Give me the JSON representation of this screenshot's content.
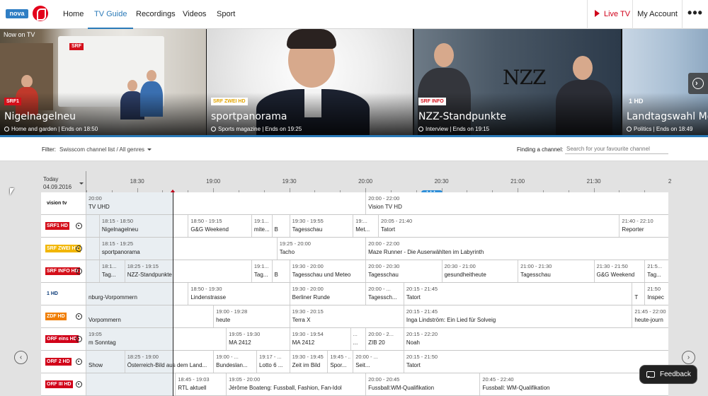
{
  "nav": {
    "logo_text": "nova",
    "items": [
      "Home",
      "TV Guide",
      "Recordings",
      "Videos",
      "Sport"
    ],
    "active_item": "TV Guide",
    "live_label": "Live TV",
    "account_label": "My Account",
    "more_label": "•••"
  },
  "hero": {
    "section_label": "Now on TV",
    "tiles": [
      {
        "title": "Nigelnagelneu",
        "meta": "Home and garden | Ends on 18:50",
        "channel": "SRF1"
      },
      {
        "title": "sportpanorama",
        "meta": "Sports magazine | Ends on 19:25",
        "channel": "SRF ZWEI HD"
      },
      {
        "title": "NZZ-Standpunkte",
        "meta": "Interview | Ends on 19:15",
        "channel": "SRF INFO"
      },
      {
        "title": "Landtagswahl Me",
        "meta": "Politics | Ends on 18:49",
        "channel": "1 HD"
      }
    ],
    "tile_texts": {
      "tile1_sign": "SRF",
      "tile3_logo": "NZZ"
    }
  },
  "filter": {
    "label": "Filter:",
    "value": "Swisscom channel list / All genres",
    "finding_label": "Finding a channel:",
    "search_placeholder": "Search for your favourite channel"
  },
  "guide": {
    "day": "Today",
    "date": "04.09.2016",
    "times": [
      "18:30",
      "19:00",
      "19:30",
      "20:00",
      "20:30",
      "21:00",
      "21:30",
      "2"
    ],
    "start_time": "18:10",
    "now_time": "18:44",
    "channels": [
      {
        "logo": "vision tv",
        "recordable": false,
        "programs": [
          {
            "start": "",
            "end": "20:00",
            "time": "20:00",
            "name": "TV UHD"
          },
          {
            "start": "20:00",
            "end": "22:00",
            "time": "20:00 - 22:00",
            "name": "Vision TV HD"
          }
        ]
      },
      {
        "logo": "SRF1 HD",
        "recordable": true,
        "programs": [
          {
            "start": "18:15",
            "end": "18:50",
            "time": "18:15 - 18:50",
            "name": "Nigelnagelneu"
          },
          {
            "start": "18:50",
            "end": "19:15",
            "time": "18:50 - 19:15",
            "name": "G&G Weekend"
          },
          {
            "start": "19:15",
            "end": "19:23",
            "time": "19:1...",
            "name": "mite..."
          },
          {
            "start": "19:23",
            "end": "19:30",
            "time": "",
            "name": "B"
          },
          {
            "start": "19:30",
            "end": "19:55",
            "time": "19:30 - 19:55",
            "name": "Tagesschau"
          },
          {
            "start": "19:55",
            "end": "20:05",
            "time": "19:...",
            "name": "Met..."
          },
          {
            "start": "20:05",
            "end": "21:40",
            "time": "20:05 - 21:40",
            "name": "Tatort"
          },
          {
            "start": "21:40",
            "end": "22:10",
            "time": "21:40 - 22:10",
            "name": "Reporter"
          }
        ]
      },
      {
        "logo": "SRF ZWEI HD",
        "recordable": true,
        "programs": [
          {
            "start": "18:15",
            "end": "19:25",
            "time": "18:15 - 19:25",
            "name": "sportpanorama"
          },
          {
            "start": "19:25",
            "end": "20:00",
            "time": "19:25 - 20:00",
            "name": "Tacho"
          },
          {
            "start": "20:00",
            "end": "22:00",
            "time": "20:00 - 22:00",
            "name": "Maze Runner - Die Auserwählten im Labyrinth"
          }
        ]
      },
      {
        "logo": "SRF INFO HD",
        "recordable": true,
        "programs": [
          {
            "start": "18:15",
            "end": "18:25",
            "time": "18:1...",
            "name": "Tag..."
          },
          {
            "start": "18:25",
            "end": "19:15",
            "time": "18:25 - 19:15",
            "name": "NZZ-Standpunkte"
          },
          {
            "start": "19:15",
            "end": "19:23",
            "time": "19:1...",
            "name": "Tag..."
          },
          {
            "start": "19:23",
            "end": "19:30",
            "time": "",
            "name": "B"
          },
          {
            "start": "19:30",
            "end": "20:00",
            "time": "19:30 - 20:00",
            "name": "Tagesschau und Meteo"
          },
          {
            "start": "20:00",
            "end": "20:30",
            "time": "20:00 - 20:30",
            "name": "Tagesschau"
          },
          {
            "start": "20:30",
            "end": "21:00",
            "time": "20:30 - 21:00",
            "name": "gesundheitheute"
          },
          {
            "start": "21:00",
            "end": "21:30",
            "time": "21:00 - 21:30",
            "name": "Tagesschau"
          },
          {
            "start": "21:30",
            "end": "21:50",
            "time": "21:30 - 21:50",
            "name": "G&G Weekend"
          },
          {
            "start": "21:50",
            "end": "22:20",
            "time": "21:5...",
            "name": "Tag..."
          }
        ]
      },
      {
        "logo": "1 HD",
        "recordable": false,
        "programs": [
          {
            "start": "",
            "end": "18:50",
            "time": "",
            "name": "nburg-Vorpommern"
          },
          {
            "start": "18:50",
            "end": "19:30",
            "time": "18:50 - 19:30",
            "name": "Lindenstrasse"
          },
          {
            "start": "19:30",
            "end": "20:00",
            "time": "19:30 - 20:00",
            "name": "Berliner Runde"
          },
          {
            "start": "20:00",
            "end": "20:15",
            "time": "20:00 - ...",
            "name": "Tagessch..."
          },
          {
            "start": "20:15",
            "end": "21:45",
            "time": "20:15 - 21:45",
            "name": "Tatort"
          },
          {
            "start": "21:45",
            "end": "21:50",
            "time": "",
            "name": "T"
          },
          {
            "start": "21:50",
            "end": "22:20",
            "time": "21:50",
            "name": "Inspec"
          }
        ]
      },
      {
        "logo": "ZDF HD",
        "recordable": true,
        "programs": [
          {
            "start": "",
            "end": "19:00",
            "time": "",
            "name": "Vorpommern"
          },
          {
            "start": "19:00",
            "end": "19:28",
            "time": "19:00 - 19:28",
            "name": "heute"
          },
          {
            "start": "19:30",
            "end": "20:15",
            "time": "19:30 - 20:15",
            "name": "Terra X"
          },
          {
            "start": "20:15",
            "end": "21:45",
            "time": "20:15 - 21:45",
            "name": "Inga Lindström: Ein Lied für Solveig"
          },
          {
            "start": "21:45",
            "end": "22:15",
            "time": "21:45 - 22:00",
            "name": "heute-journ"
          }
        ]
      },
      {
        "logo": "ORF eins HD",
        "recordable": true,
        "programs": [
          {
            "start": "",
            "end": "19:05",
            "time": "19:05",
            "name": "m Sonntag"
          },
          {
            "start": "19:05",
            "end": "19:30",
            "time": "19:05 - 19:30",
            "name": "MA 2412"
          },
          {
            "start": "19:30",
            "end": "19:54",
            "time": "19:30 - 19:54",
            "name": "MA 2412"
          },
          {
            "start": "19:54",
            "end": "20:00",
            "time": "...",
            "name": "..."
          },
          {
            "start": "20:00",
            "end": "20:15",
            "time": "20:00 - 2...",
            "name": "ZIB 20"
          },
          {
            "start": "20:15",
            "end": "22:20",
            "time": "20:15 - 22:20",
            "name": "Noah"
          }
        ]
      },
      {
        "logo": "ORF 2 HD",
        "recordable": true,
        "programs": [
          {
            "start": "",
            "end": "18:25",
            "time": "",
            "name": "Show"
          },
          {
            "start": "18:25",
            "end": "19:00",
            "time": "18:25 - 19:00",
            "name": "Österreich-Bild aus dem Land..."
          },
          {
            "start": "19:00",
            "end": "19:17",
            "time": "19:00 - ...",
            "name": "Bundeslan..."
          },
          {
            "start": "19:17",
            "end": "19:30",
            "time": "19:17 - ...",
            "name": "Lotto 6 ..."
          },
          {
            "start": "19:30",
            "end": "19:45",
            "time": "19:30 - 19:45",
            "name": "Zeit im Bild"
          },
          {
            "start": "19:45",
            "end": "19:55",
            "time": "19:45 - ...",
            "name": "Spor..."
          },
          {
            "start": "19:55",
            "end": "20:15",
            "time": "20:00 - ...",
            "name": "Seit..."
          },
          {
            "start": "20:15",
            "end": "22:20",
            "time": "20:15 - 21:50",
            "name": "Tatort"
          }
        ]
      },
      {
        "logo": "ORF III HD",
        "recordable": true,
        "programs": [
          {
            "start": "18:45",
            "end": "19:03",
            "time": "18:45 - 19:03",
            "name": "RTL aktuell"
          },
          {
            "start": "19:05",
            "end": "20:00",
            "time": "19:05 - 20:00",
            "name": "Jérôme Boateng: Fussball, Fashion, Fan-Idol"
          },
          {
            "start": "20:00",
            "end": "20:45",
            "time": "20:00 - 20:45",
            "name": "Fussball:WM-Qualifikation"
          },
          {
            "start": "20:45",
            "end": "22:20",
            "time": "20:45 - 22:40",
            "name": "Fussball: WM-Qualifikation"
          }
        ]
      }
    ]
  },
  "feedback_label": "Feedback",
  "colors": {
    "accent": "#2a7ab8",
    "live": "#d0021b",
    "brand_red": "#e3001b"
  }
}
